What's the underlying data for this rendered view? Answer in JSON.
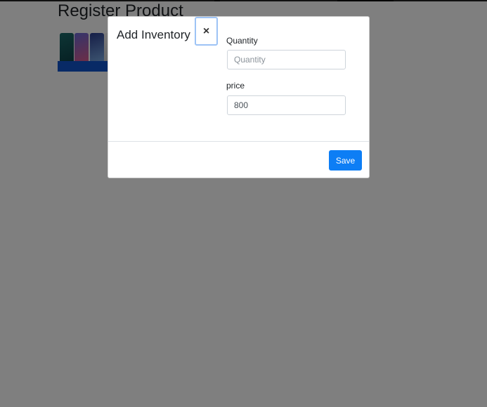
{
  "page": {
    "title": "Register Product"
  },
  "product_card": {
    "image_icon": "phones-image"
  },
  "modal": {
    "title": "Add Inventory",
    "close_glyph": "×",
    "close_icon": "close-icon",
    "fields": {
      "quantity": {
        "label": "Quantity",
        "placeholder": "Quantity",
        "value": ""
      },
      "price": {
        "label": "price",
        "placeholder": "",
        "value": "800"
      }
    },
    "save_label": "Save"
  },
  "colors": {
    "primary": "#0d7ef5",
    "backdrop": "rgba(0,0,0,0.5)",
    "product_bar": "#1155cc"
  }
}
